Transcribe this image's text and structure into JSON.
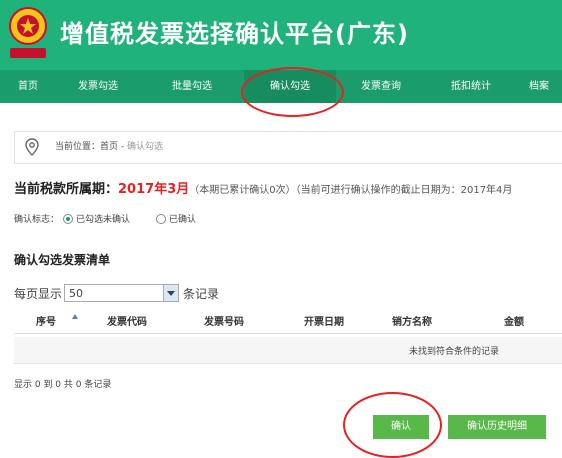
{
  "header": {
    "title": "增值税发票选择确认平台(广东)",
    "logo_icon": "tax-emblem-icon",
    "background": "#1fb27b"
  },
  "nav": {
    "items": [
      {
        "label": "首页"
      },
      {
        "label": "发票勾选"
      },
      {
        "label": "批量勾选"
      },
      {
        "label": "确认勾选"
      },
      {
        "label": "发票查询"
      },
      {
        "label": "抵扣统计"
      },
      {
        "label": "档案"
      }
    ],
    "active_label": "确认勾选"
  },
  "breadcrumb": {
    "icon": "location-pin-icon",
    "prefix": "当前位置：首页 - ",
    "current": "确认勾选"
  },
  "period": {
    "label": "当前税款所属期：",
    "value": "2017年3月",
    "note": "（本期已累计确认0次）（当前可进行确认操作的截止日期为：2017年4月"
  },
  "status": {
    "label": "确认标志：",
    "options": [
      "已勾选未确认",
      "已确认"
    ],
    "selected": "已勾选未确认"
  },
  "list": {
    "title": "确认勾选发票清单",
    "per_page_prefix": "每页显示",
    "per_page_value": "50",
    "per_page_suffix": "条记录",
    "columns": [
      "序号",
      "发票代码",
      "发票号码",
      "开票日期",
      "销方名称",
      "金额"
    ],
    "empty_text": "未找到符合条件的记录",
    "summary": "显示 0 到 0 共 0 条记录"
  },
  "actions": {
    "confirm_label": "确认",
    "history_label": "确认历史明细",
    "button_color": "#58b94a"
  },
  "highlight_color": "#e52222"
}
